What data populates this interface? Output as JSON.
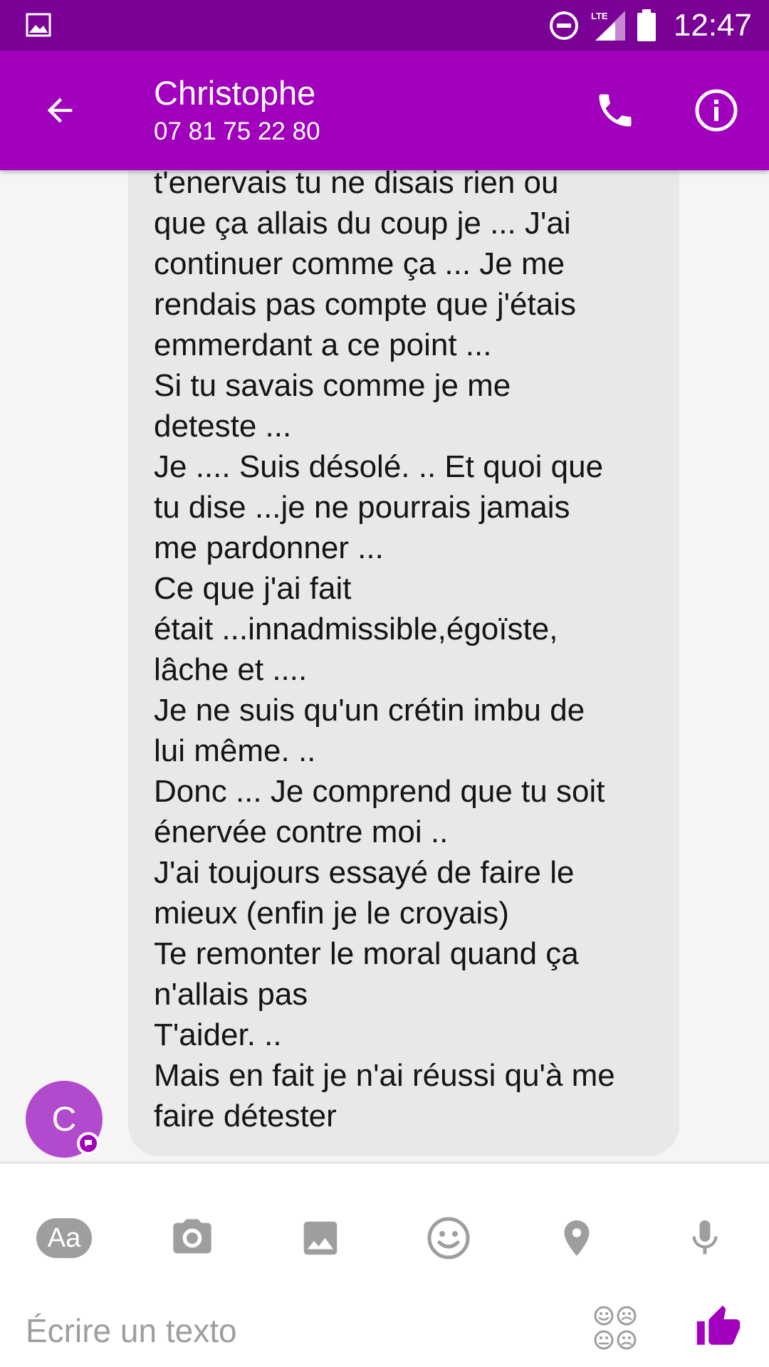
{
  "status_bar": {
    "time": "12:47",
    "network": "LTE",
    "icons": [
      "gallery-notification-icon",
      "do-not-disturb-icon",
      "lte-signal-icon",
      "battery-icon"
    ]
  },
  "header": {
    "contact_name": "Christophe",
    "phone_number": "07 81 75 22 80",
    "icons": [
      "back-arrow-icon",
      "phone-icon",
      "info-icon"
    ]
  },
  "conversation": {
    "avatar_initial": "C",
    "message_lines": [
      "t'enervais tu ne disais rien ou",
      "que ça allais du coup je ... J'ai",
      "continuer comme ça ... Je me",
      "rendais pas compte que j'étais",
      "emmerdant a ce point ...",
      "Si tu savais comme je me",
      "deteste ...",
      "Je .... Suis désolé. .. Et quoi que",
      "tu dise ...je ne pourrais jamais",
      "me pardonner ...",
      "Ce que j'ai fait",
      "était ...innadmissible,égoïste,",
      "lâche et ....",
      "Je ne suis qu'un crétin imbu de",
      "lui même. ..",
      "Donc ... Je comprend que tu soit",
      "énervée contre moi ..",
      "J'ai toujours essayé de faire le",
      "mieux (enfin je le croyais)",
      "Te remonter le moral quand ça",
      "n'allais pas",
      "T'aider. ..",
      "Mais en fait je n'ai réussi qu'à me",
      "faire détester"
    ]
  },
  "composer": {
    "text_tool_label": "Aa",
    "placeholder": "Écrire un texto",
    "toolbar_icons": [
      "text-format-icon",
      "camera-icon",
      "gallery-icon",
      "emoji-icon",
      "location-pin-icon",
      "microphone-icon"
    ],
    "trailing_icons": [
      "stickers-icon",
      "thumbs-up-icon"
    ]
  },
  "colors": {
    "status_bar": "#7b0095",
    "app_bar": "#a100bd",
    "avatar": "#b24acd",
    "bubble": "#e8e8e8",
    "toolbar_icons": "#9e9e9e",
    "accent": "#a100bd"
  }
}
